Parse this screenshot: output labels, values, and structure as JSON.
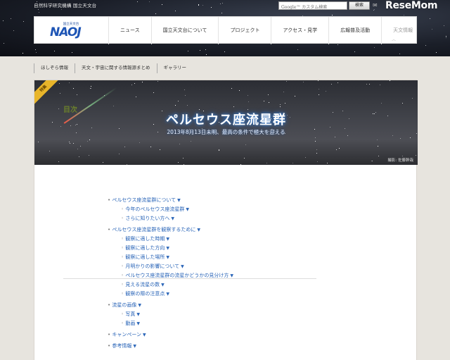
{
  "header": {
    "org_name": "自然科学研究機構 国立天文台",
    "search_placeholder": "カスタム検索",
    "search_google": "Google™",
    "search_button": "検索",
    "watermark": "ReseMom"
  },
  "logo": {
    "small_text": "国立天文台",
    "big_text": "NAOJ"
  },
  "nav": {
    "items": [
      "ニュース",
      "国立天文台について",
      "プロジェクト",
      "アクセス・見学",
      "広報普及活動",
      "天文情報"
    ]
  },
  "subnav": {
    "items": [
      "ほしぞら情報",
      "天文・宇宙に関する情報源まとめ",
      "ギャラリー"
    ]
  },
  "banner": {
    "badge": "特集",
    "title": "ペルセウス座流星群",
    "subtitle": "2013年8月13日未明、最高の条件で極大を迎える",
    "credit": "撮影: 佐藤幹哉"
  },
  "toc": {
    "title": "目次",
    "items": [
      {
        "level": 1,
        "label": "ペルセウス座流星群について"
      },
      {
        "level": 2,
        "label": "今年のペルセウス座流星群"
      },
      {
        "level": 2,
        "label": "さらに知りたい方へ"
      },
      {
        "level": 1,
        "label": "ペルセウス座流星群を観察するために"
      },
      {
        "level": 2,
        "label": "観察に適した時期"
      },
      {
        "level": 2,
        "label": "観察に適した方向"
      },
      {
        "level": 2,
        "label": "観察に適した場所"
      },
      {
        "level": 2,
        "label": "月明かりの影響について"
      },
      {
        "level": 2,
        "label": "ペルセウス座流星群の流星かどうかの見分け方"
      },
      {
        "level": 2,
        "label": "見える流星の数"
      },
      {
        "level": 2,
        "label": "観察の際の注意点"
      },
      {
        "level": 1,
        "label": "流星の画像"
      },
      {
        "level": 2,
        "label": "写真"
      },
      {
        "level": 2,
        "label": "動画"
      },
      {
        "level": 1,
        "label": "キャンペーン"
      },
      {
        "level": 1,
        "label": "参考情報"
      }
    ]
  },
  "colors": {
    "link": "#2a65b8",
    "toc_title": "#6b7f2c",
    "badge": "#e8b52a"
  }
}
